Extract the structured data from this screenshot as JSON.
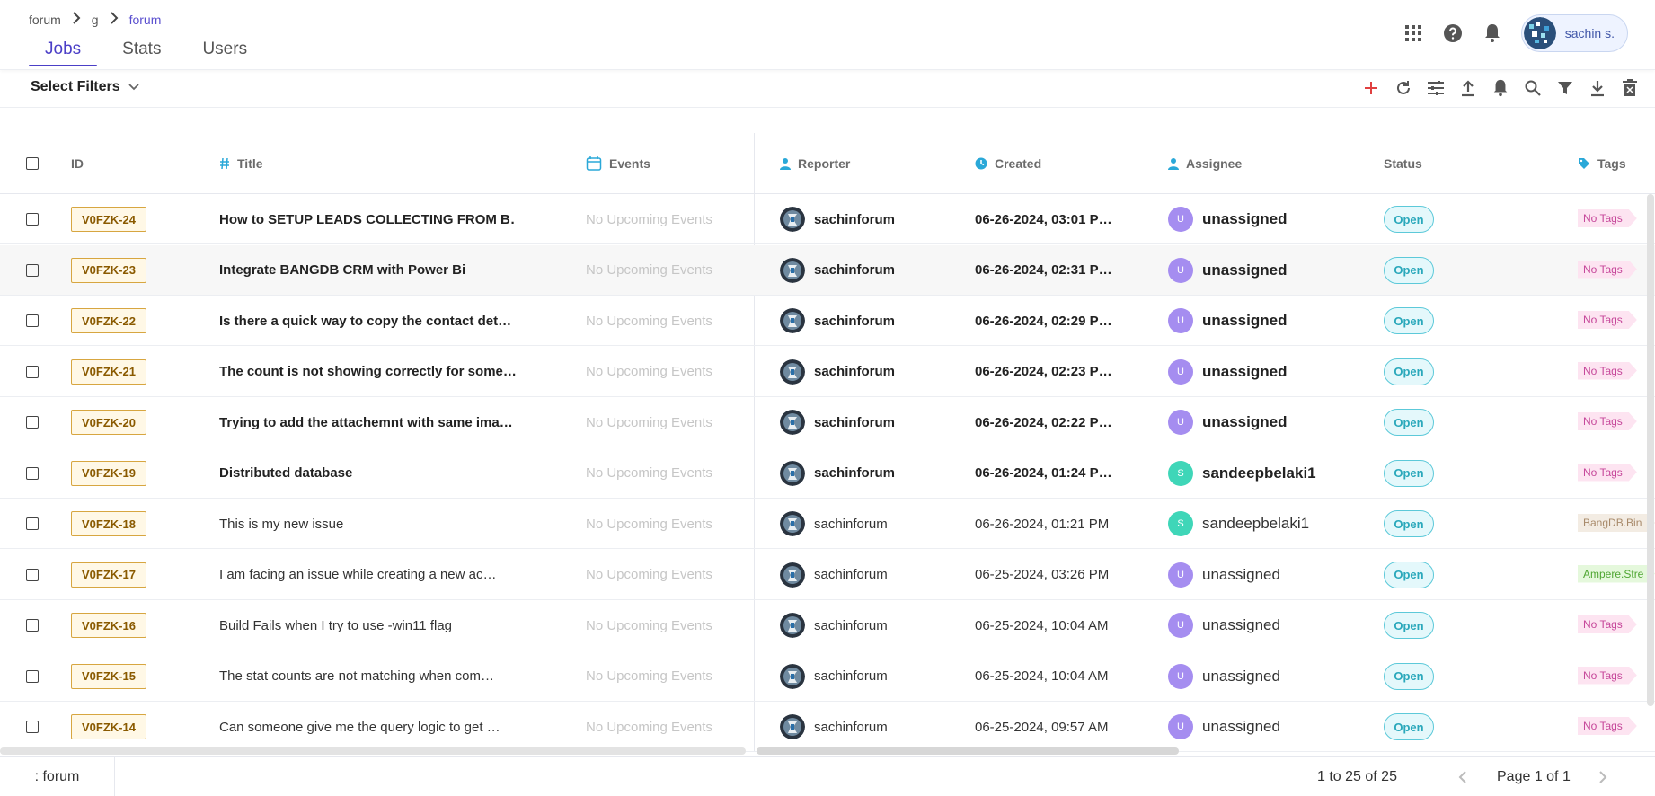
{
  "breadcrumb": [
    "forum",
    "g",
    "forum"
  ],
  "tabs": [
    {
      "label": "Jobs",
      "active": true
    },
    {
      "label": "Stats",
      "active": false
    },
    {
      "label": "Users",
      "active": false
    }
  ],
  "user": {
    "name": "sachin s."
  },
  "filters": {
    "label": "Select Filters"
  },
  "columns": {
    "id": "ID",
    "title": "Title",
    "events": "Events",
    "reporter": "Reporter",
    "created": "Created",
    "assignee": "Assignee",
    "status": "Status",
    "tags": "Tags"
  },
  "colors": {
    "accent": "#4b3fc7",
    "status_open": "#2aa8bb",
    "assignee_u": "#a58df0",
    "assignee_s": "#3fd6b8"
  },
  "rows": [
    {
      "id": "V0FZK-24",
      "title": "How to SETUP LEADS COLLECTING FROM B…",
      "events": "No Upcoming Events",
      "reporter": "sachinforum",
      "created": "06-26-2024, 03:01 P…",
      "assignee": "unassigned",
      "assignee_initial": "U",
      "status": "Open",
      "tag": "No Tags",
      "bold": true
    },
    {
      "id": "V0FZK-23",
      "title": "Integrate BANGDB CRM with Power Bi",
      "events": "No Upcoming Events",
      "reporter": "sachinforum",
      "created": "06-26-2024, 02:31 P…",
      "assignee": "unassigned",
      "assignee_initial": "U",
      "status": "Open",
      "tag": "No Tags",
      "bold": true
    },
    {
      "id": "V0FZK-22",
      "title": "Is there a quick way to copy the contact det…",
      "events": "No Upcoming Events",
      "reporter": "sachinforum",
      "created": "06-26-2024, 02:29 P…",
      "assignee": "unassigned",
      "assignee_initial": "U",
      "status": "Open",
      "tag": "No Tags",
      "bold": true
    },
    {
      "id": "V0FZK-21",
      "title": "The count is not showing correctly for some…",
      "events": "No Upcoming Events",
      "reporter": "sachinforum",
      "created": "06-26-2024, 02:23 P…",
      "assignee": "unassigned",
      "assignee_initial": "U",
      "status": "Open",
      "tag": "No Tags",
      "bold": true
    },
    {
      "id": "V0FZK-20",
      "title": "Trying to add the attachemnt with same ima…",
      "events": "No Upcoming Events",
      "reporter": "sachinforum",
      "created": "06-26-2024, 02:22 P…",
      "assignee": "unassigned",
      "assignee_initial": "U",
      "status": "Open",
      "tag": "No Tags",
      "bold": true
    },
    {
      "id": "V0FZK-19",
      "title": "Distributed database",
      "events": "No Upcoming Events",
      "reporter": "sachinforum",
      "created": "06-26-2024, 01:24 P…",
      "assignee": "sandeepbelaki1",
      "assignee_initial": "S",
      "status": "Open",
      "tag": "No Tags",
      "bold": true
    },
    {
      "id": "V0FZK-18",
      "title": "This is my new issue",
      "events": "No Upcoming Events",
      "reporter": "sachinforum",
      "created": "06-26-2024, 01:21 PM",
      "assignee": "sandeepbelaki1",
      "assignee_initial": "S",
      "status": "Open",
      "tag": "BangDB.Bin",
      "bold": false
    },
    {
      "id": "V0FZK-17",
      "title": "I am facing an issue while creating a new ac…",
      "events": "No Upcoming Events",
      "reporter": "sachinforum",
      "created": "06-25-2024, 03:26 PM",
      "assignee": "unassigned",
      "assignee_initial": "U",
      "status": "Open",
      "tag": "Ampere.Stre",
      "bold": false
    },
    {
      "id": "V0FZK-16",
      "title": "Build Fails when I try to use -win11 flag",
      "events": "No Upcoming Events",
      "reporter": "sachinforum",
      "created": "06-25-2024, 10:04 AM",
      "assignee": "unassigned",
      "assignee_initial": "U",
      "status": "Open",
      "tag": "No Tags",
      "bold": false
    },
    {
      "id": "V0FZK-15",
      "title": "The stat counts are not matching when com…",
      "events": "No Upcoming Events",
      "reporter": "sachinforum",
      "created": "06-25-2024, 10:04 AM",
      "assignee": "unassigned",
      "assignee_initial": "U",
      "status": "Open",
      "tag": "No Tags",
      "bold": false
    },
    {
      "id": "V0FZK-14",
      "title": "Can someone give me the query logic to get …",
      "events": "No Upcoming Events",
      "reporter": "sachinforum",
      "created": "06-25-2024, 09:57 AM",
      "assignee": "unassigned",
      "assignee_initial": "U",
      "status": "Open",
      "tag": "No Tags",
      "bold": false
    }
  ],
  "footer": {
    "tab_label": ": forum",
    "count": "1 to 25 of 25",
    "page": "Page 1 of 1"
  }
}
